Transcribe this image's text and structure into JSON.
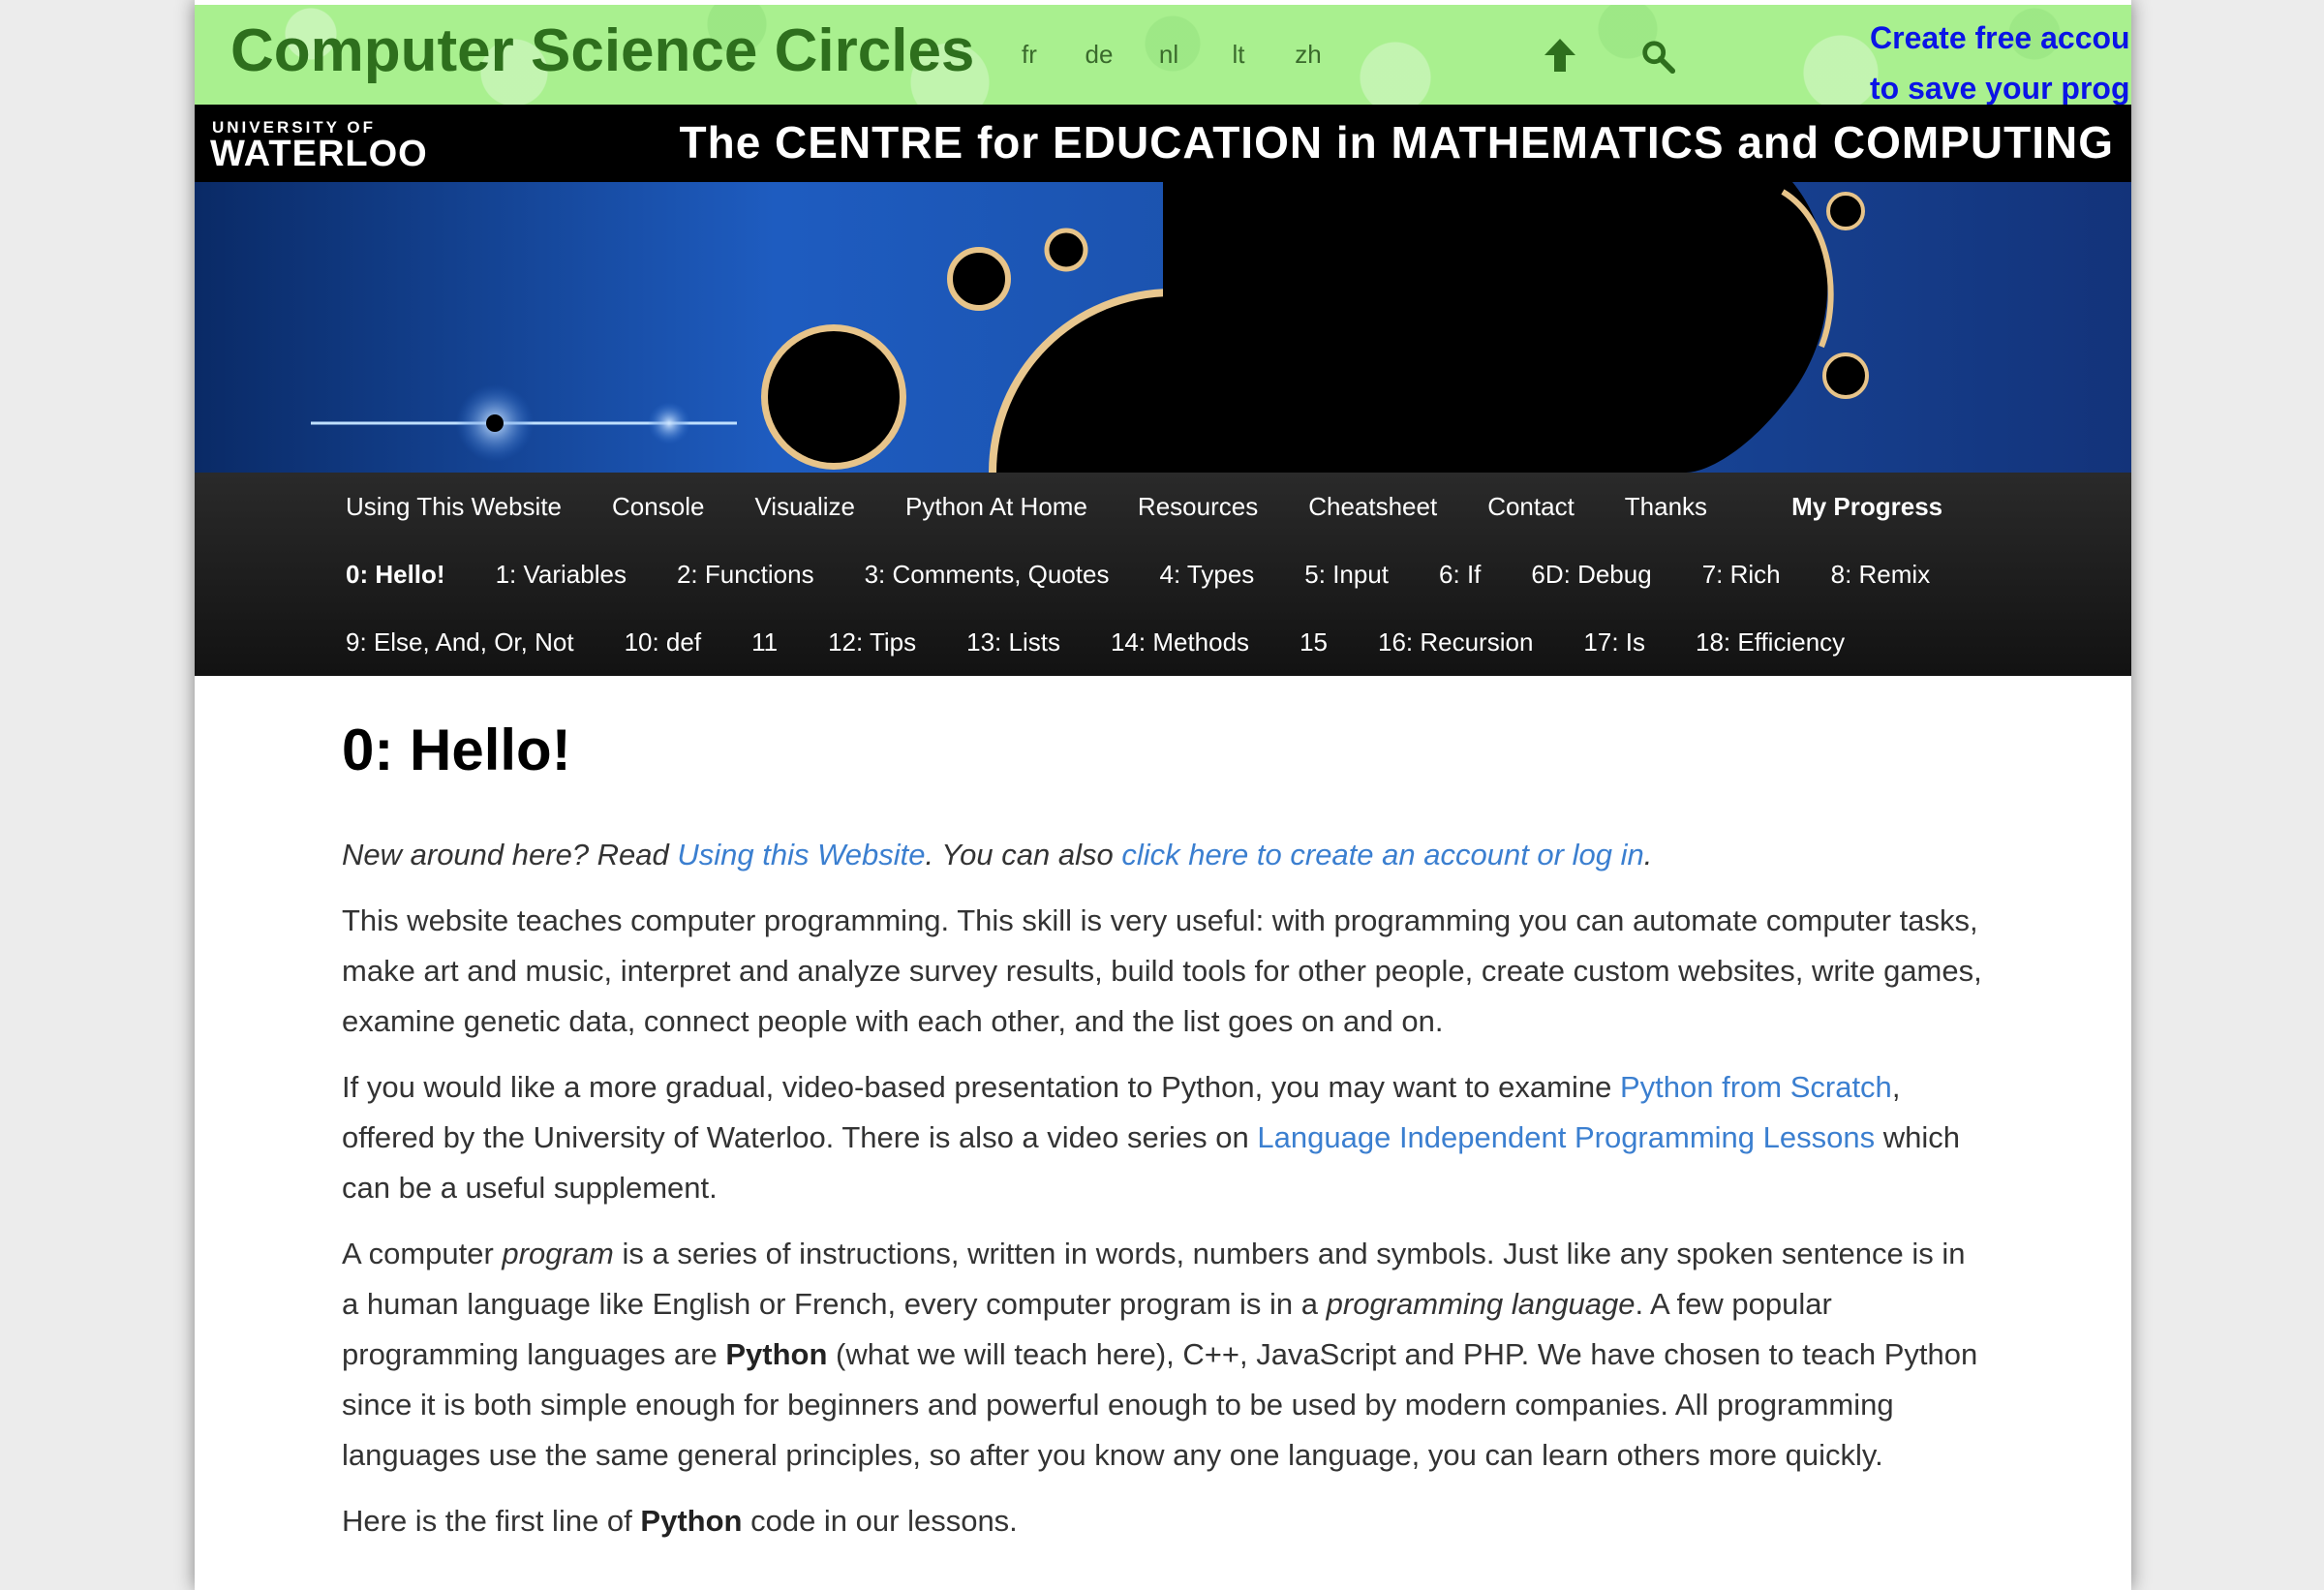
{
  "header": {
    "site_title": "Computer Science Circles",
    "languages": [
      "fr",
      "de",
      "nl",
      "lt",
      "zh"
    ],
    "login_line1": "Create free account / login",
    "login_line2": "to save your progress",
    "up_icon": "up-arrow-icon",
    "search_icon": "search-icon"
  },
  "banner": {
    "uw_small": "UNIVERSITY OF",
    "uw_big": "WATERLOO",
    "cemc": "The CENTRE for EDUCATION in MATHEMATICS and COMPUTING"
  },
  "nav": {
    "row1": [
      "Using This Website",
      "Console",
      "Visualize",
      "Python At Home",
      "Resources",
      "Cheatsheet",
      "Contact",
      "Thanks"
    ],
    "my_progress": "My Progress",
    "row2": [
      "0: Hello!",
      "1: Variables",
      "2: Functions",
      "3: Comments, Quotes",
      "4: Types",
      "5: Input",
      "6: If",
      "6D: Debug",
      "7: Rich",
      "8: Remix"
    ],
    "row3": [
      "9: Else, And, Or, Not",
      "10: def",
      "11",
      "12: Tips",
      "13: Lists",
      "14: Methods",
      "15",
      "16: Recursion",
      "17: Is",
      "18: Efficiency"
    ]
  },
  "content": {
    "title": "0: Hello!",
    "intro_1": "New around here? Read ",
    "intro_link1": "Using this Website",
    "intro_2": ". You can also ",
    "intro_link2": "click here to create an account or log in",
    "intro_3": ".",
    "p1": "This website teaches computer programming. This skill is very useful: with programming you can automate computer tasks, make art and music, interpret and analyze survey results, build tools for other people, create custom websites, write games, examine genetic data, connect people with each other, and the list goes on and on.",
    "p2_a": "If you would like a more gradual, video-based presentation to Python, you may want to examine ",
    "p2_link1": "Python from Scratch",
    "p2_b": ", offered by the University of Waterloo. There is also a video series on ",
    "p2_link2": "Language Independent Programming Lessons",
    "p2_c": " which can be a useful supplement.",
    "p3_a": "A computer ",
    "p3_em1": "program",
    "p3_b": " is a series of instructions, written in words, numbers and symbols. Just like any spoken sentence is in a human language like English or French, every computer program is in a ",
    "p3_em2": "programming language",
    "p3_c": ". A few popular programming languages are ",
    "p3_bold": "Python",
    "p3_d": " (what we will teach here), C++, JavaScript and PHP. We have chosen to teach Python since it is both simple enough for beginners and powerful enough to be used by modern companies. All programming languages use the same general principles, so after you know any one language, you can learn others more quickly.",
    "p4_a": "Here is the first line of ",
    "p4_bold": "Python",
    "p4_b": " code in our lessons."
  },
  "colors": {
    "topbar": "#a9f08f",
    "title_green": "#2e6f1d",
    "login_blue": "#0a14e6",
    "link_blue": "#3b7fd0"
  }
}
